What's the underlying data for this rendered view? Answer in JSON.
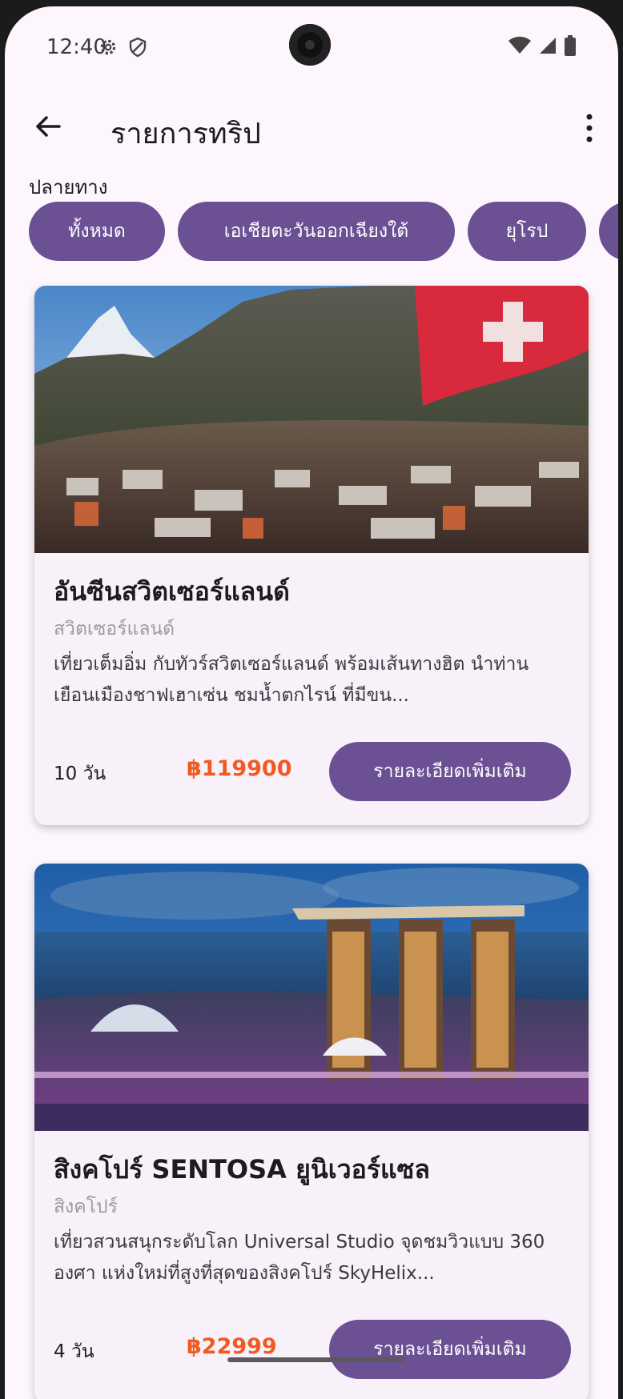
{
  "status_bar": {
    "time": "12:40"
  },
  "app_bar": {
    "title": "รายการทริป"
  },
  "filter": {
    "label": "ปลายทาง",
    "chips": [
      "ทั้งหมด",
      "เอเชียตะวันออกเฉียงใต้",
      "ยุโรป"
    ]
  },
  "trips": [
    {
      "title": "อันซีนสวิตเซอร์แลนด์",
      "country": "สวิตเซอร์แลนด์",
      "description": "เที่ยวเต็มอิ่ม กับทัวร์สวิตเซอร์แลนด์ พร้อมเส้นทางฮิต นำท่านเยือนเมืองชาฟเฮาเซ่น ชมน้ำตกไรน์ ที่มีขน...",
      "days": "10 วัน",
      "price": "฿119900",
      "button": "รายละเอียดเพิ่มเติม"
    },
    {
      "title": "สิงคโปร์ SENTOSA ยูนิเวอร์แซล",
      "country": "สิงคโปร์",
      "description": "เที่ยวสวนสนุกระดับโลก Universal Studio จุดชมวิวแบบ 360 องศา แห่งใหม่ที่สูงที่สุดของสิงคโปร์ SkyHelix...",
      "days": "4 วัน",
      "price": "฿22999",
      "button": "รายละเอียดเพิ่มเติม"
    }
  ],
  "colors": {
    "primary": "#6b5094",
    "price": "#f05a22",
    "background": "#fdf6fd"
  }
}
